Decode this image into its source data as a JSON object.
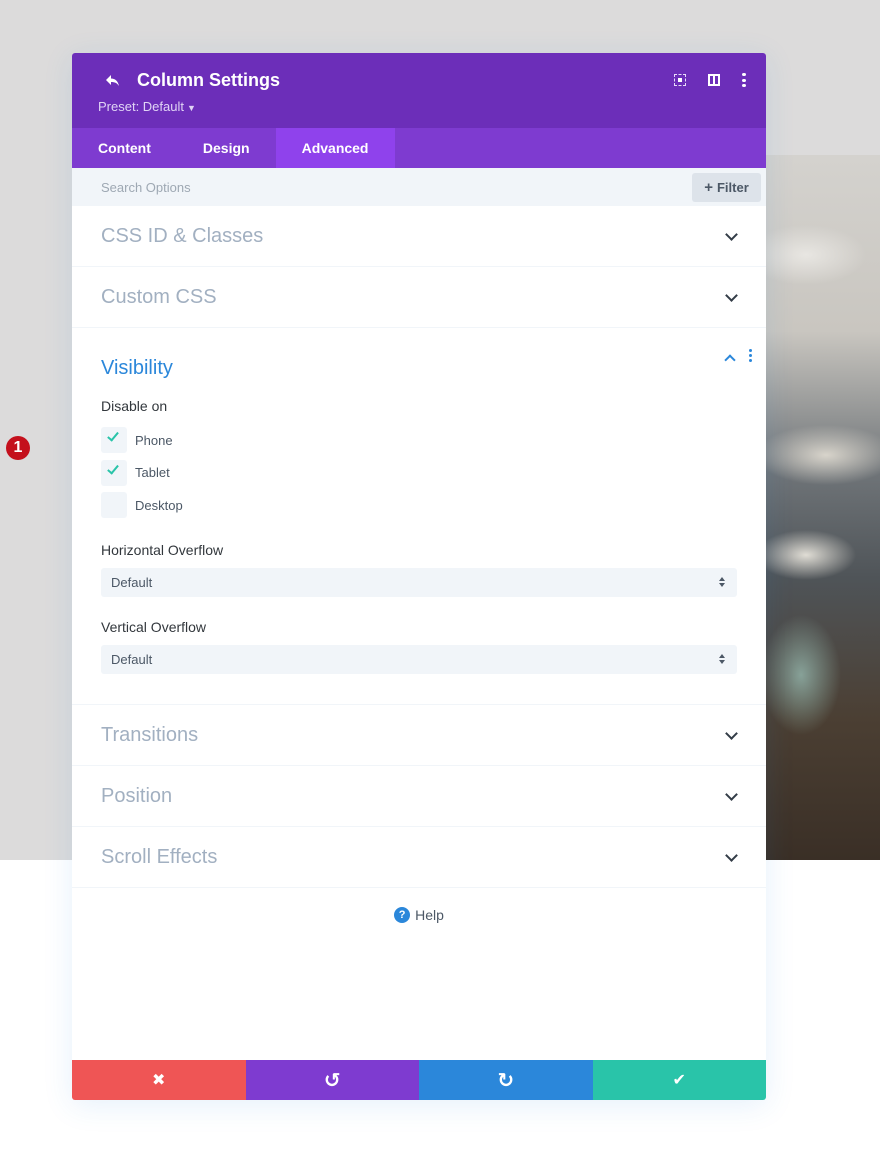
{
  "header": {
    "title": "Column Settings",
    "preset": "Preset: Default",
    "icons": [
      "back-arrow-icon",
      "focus-mode-icon",
      "split-view-icon",
      "more-options-icon"
    ]
  },
  "tabs": [
    {
      "label": "Content",
      "active": false
    },
    {
      "label": "Design",
      "active": false
    },
    {
      "label": "Advanced",
      "active": true
    }
  ],
  "search": {
    "placeholder": "Search Options",
    "filter_label": "Filter"
  },
  "sections": {
    "css_id": {
      "title": "CSS ID & Classes",
      "expanded": false
    },
    "custom_css": {
      "title": "Custom CSS",
      "expanded": false
    },
    "visibility": {
      "title": "Visibility",
      "expanded": true,
      "disable_on_label": "Disable on",
      "options": [
        {
          "label": "Phone",
          "checked": true
        },
        {
          "label": "Tablet",
          "checked": true
        },
        {
          "label": "Desktop",
          "checked": false
        }
      ],
      "horizontal_overflow": {
        "label": "Horizontal Overflow",
        "value": "Default"
      },
      "vertical_overflow": {
        "label": "Vertical Overflow",
        "value": "Default"
      }
    },
    "transitions": {
      "title": "Transitions",
      "expanded": false
    },
    "position": {
      "title": "Position",
      "expanded": false
    },
    "scroll_effects": {
      "title": "Scroll Effects",
      "expanded": false
    }
  },
  "annotation_marker": "1",
  "help": {
    "label": "Help",
    "icon_glyph": "?"
  },
  "footer": {
    "cancel_glyph": "✖",
    "undo_glyph": "↺",
    "redo_glyph": "↻",
    "save_glyph": "✔"
  },
  "colors": {
    "header": "#6c2eb9",
    "tabs": "#7e3bd0",
    "active_tab": "#8f42ec",
    "accent_blue": "#2b87da",
    "check": "#29c4a9",
    "cancel": "#ef5555",
    "undo": "#7e3bd0",
    "redo": "#2b87da",
    "save": "#29c4a9"
  }
}
